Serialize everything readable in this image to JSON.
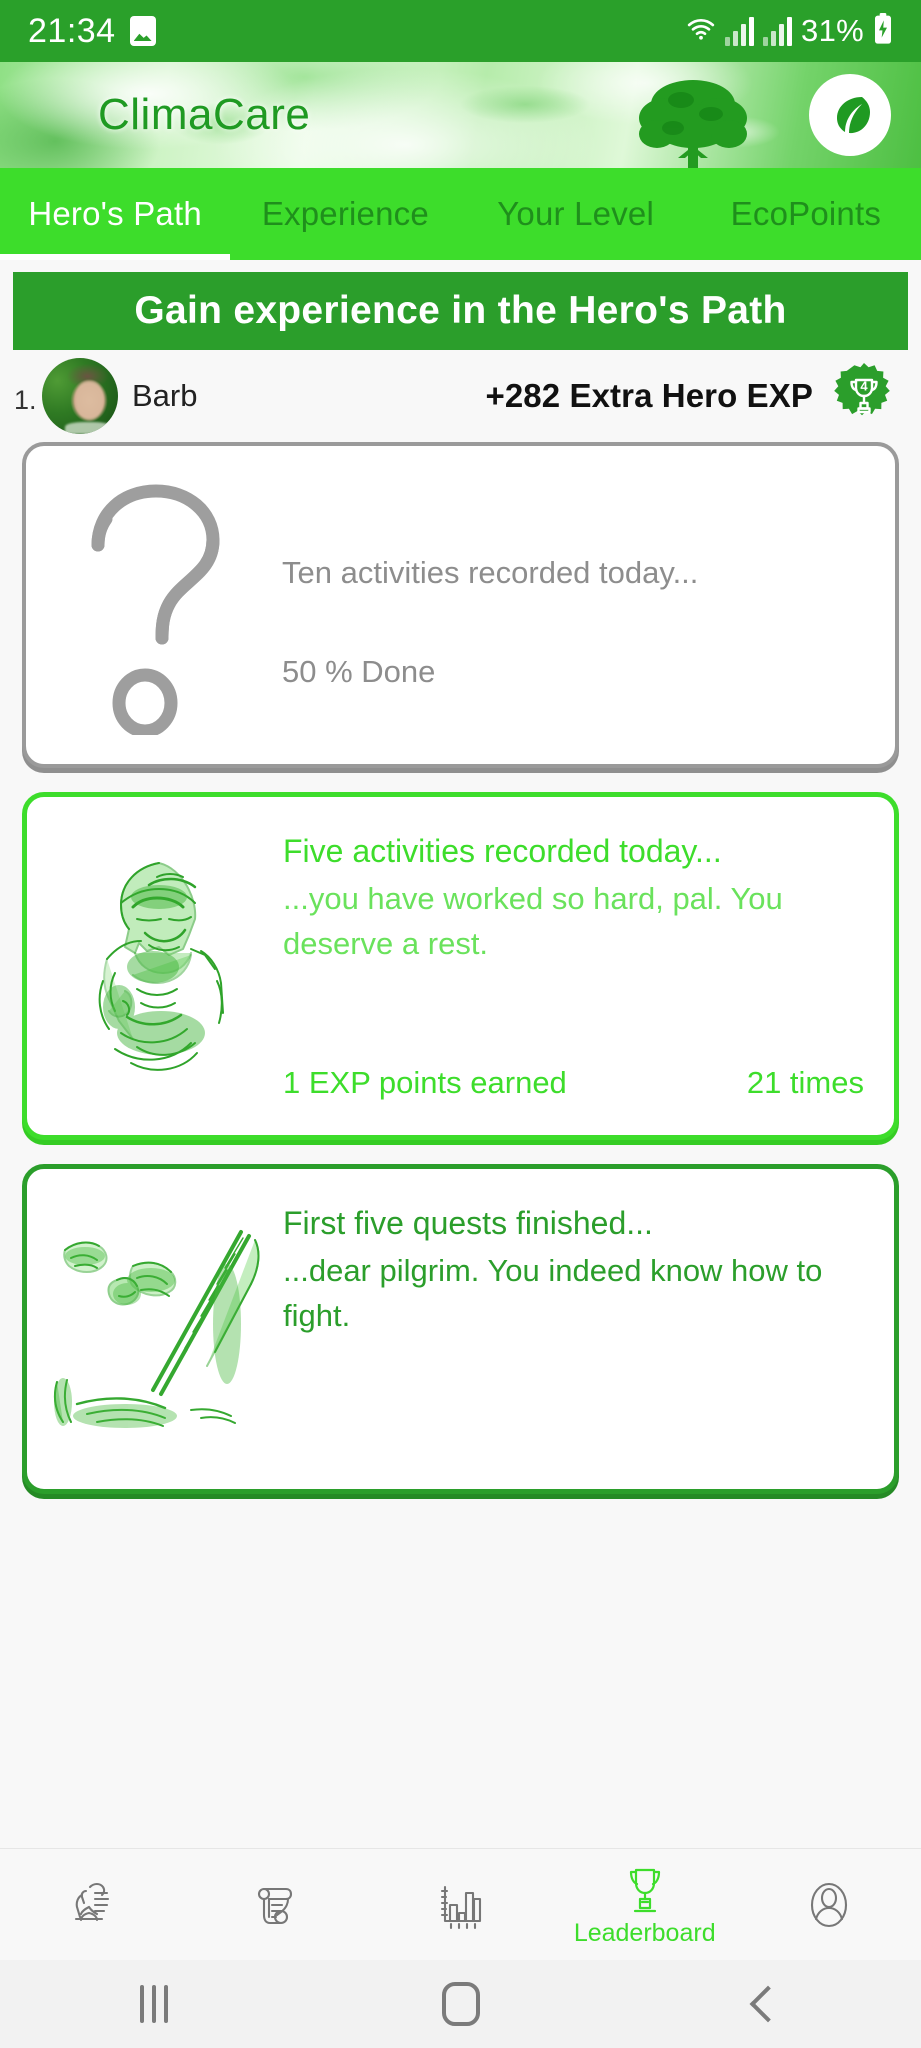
{
  "status_bar": {
    "time": "21:34",
    "image_icon": "image-icon",
    "wifi_icon": "wifi-icon",
    "signal_icon": "signal-bars-icon",
    "battery_percent": "31%",
    "battery_icon": "battery-charging-icon"
  },
  "header": {
    "app_name": "ClimaCare",
    "logo_icon": "leaf-logo-icon",
    "tree_icon": "tree-icon",
    "brand_green": "#2b9e2b",
    "accent_green": "#3ddd2b"
  },
  "tabs": [
    {
      "label": "Hero's Path",
      "active": true
    },
    {
      "label": "Experience",
      "active": false
    },
    {
      "label": "Your Level",
      "active": false
    },
    {
      "label": "EcoPoints",
      "active": false
    }
  ],
  "banner": {
    "title": "Gain experience in the Hero's Path"
  },
  "leader_row": {
    "rank": "1.",
    "avatar_icon": "user-avatar-photo",
    "name": "Barb",
    "extra_exp": "+282 Extra Hero EXP",
    "badge_icon": "trophy-badge-icon",
    "badge_level": "4"
  },
  "cards": [
    {
      "state": "locked",
      "art_icon": "question-mark-icon",
      "title": "Ten activities recorded today...",
      "description": "",
      "progress": "50 % Done",
      "exp_earned": "",
      "times": ""
    },
    {
      "state": "unlocked-light",
      "art_icon": "knight-sketch-icon",
      "title": "Five activities recorded today...",
      "description": "...you have worked so hard, pal. You deserve a rest.",
      "progress": "",
      "exp_earned": "1 EXP points earned",
      "times": "21 times"
    },
    {
      "state": "unlocked-dark",
      "art_icon": "hands-sword-sketch-icon",
      "title": "First five quests finished...",
      "description": "...dear pilgrim. You indeed know how to fight.",
      "progress": "",
      "exp_earned": "",
      "times": ""
    }
  ],
  "bottom_nav": [
    {
      "icon": "hand-seed-icon",
      "label": "",
      "active": false
    },
    {
      "icon": "scroll-quest-icon",
      "label": "",
      "active": false
    },
    {
      "icon": "bar-chart-icon",
      "label": "",
      "active": false
    },
    {
      "icon": "trophy-icon",
      "label": "Leaderboard",
      "active": true
    },
    {
      "icon": "profile-person-icon",
      "label": "",
      "active": false
    }
  ],
  "android_nav": {
    "recents": "recents-icon",
    "home": "home-icon",
    "back": "back-icon"
  }
}
